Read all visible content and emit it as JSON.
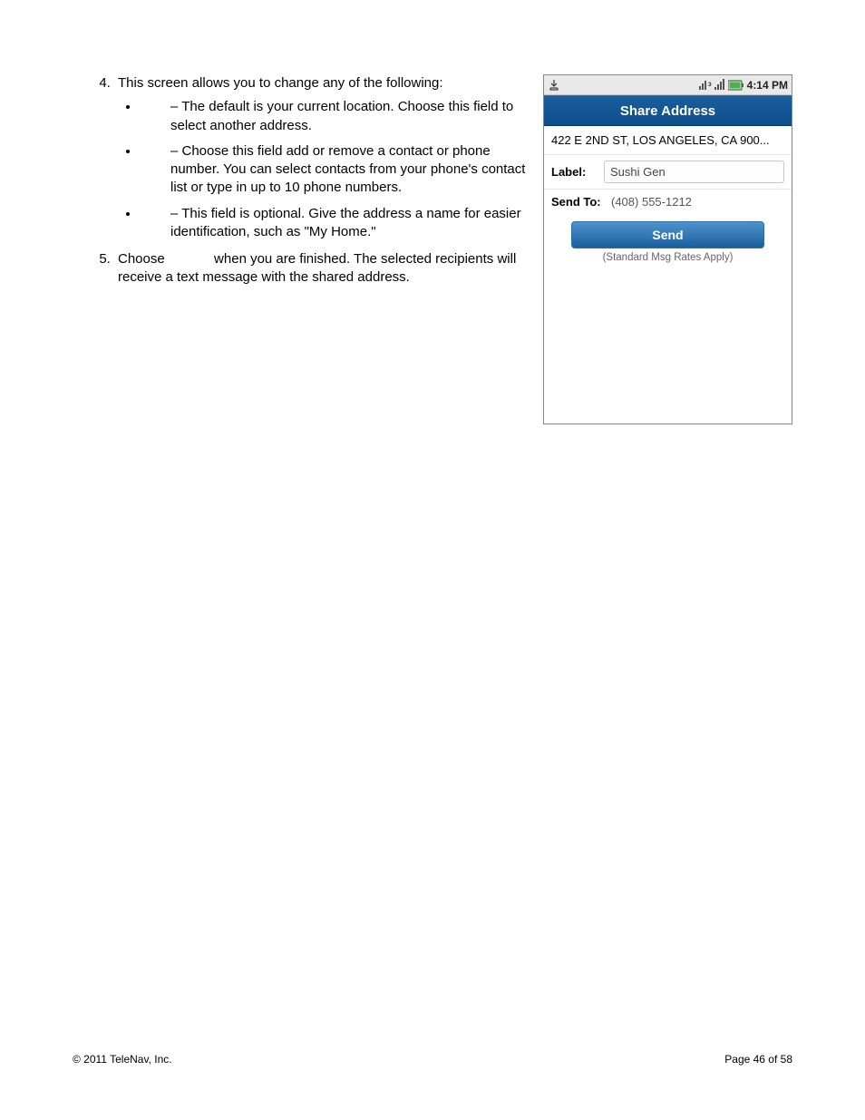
{
  "text": {
    "item4_intro": "This screen allows you to change any of the following:",
    "b1": "– The default is your current location. Choose this field to select another address.",
    "b2": "– Choose this field add or remove a contact or phone number. You can select contacts from your phone's contact list or type in up to 10 phone numbers.",
    "b3": "– This field is optional. Give the address a name for easier identification, such as \"My Home.\"",
    "item5_a": "Choose",
    "item5_b": "when you are finished. The selected recipients will receive a text message with the shared address."
  },
  "phone": {
    "time": "4:14 PM",
    "title": "Share Address",
    "address": "422 E 2ND ST, LOS ANGELES, CA 900...",
    "label_caption": "Label:",
    "label_value": "Sushi Gen",
    "sendto_caption": "Send To:",
    "sendto_value": "(408) 555-1212",
    "send_button": "Send",
    "rates": "(Standard Msg Rates Apply)"
  },
  "footer": {
    "left": "© 2011 TeleNav, Inc.",
    "right": "Page 46 of 58"
  }
}
